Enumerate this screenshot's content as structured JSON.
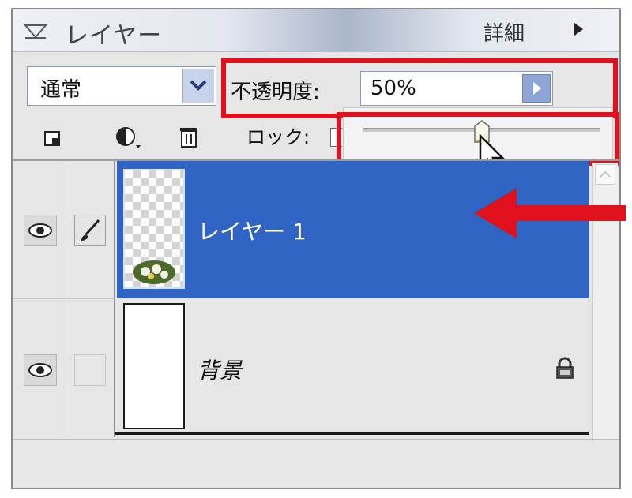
{
  "panel": {
    "title": "レイヤー",
    "details_label": "詳細"
  },
  "options": {
    "blend_mode": "通常",
    "opacity_label": "不透明度:",
    "opacity_value": "50%",
    "opacity_slider_fraction": 0.5,
    "lock_label": "ロック:"
  },
  "layers": [
    {
      "name": "レイヤー 1",
      "selected": true
    },
    {
      "name": "背景",
      "selected": false,
      "locked": true
    }
  ],
  "icons": [
    "collapse-triangle-icon",
    "menu-arrow-icon",
    "new-layer-icon",
    "adjustment-layer-icon",
    "trash-icon",
    "eye-icon",
    "brush-icon",
    "lock-icon"
  ],
  "colors": {
    "selection": "#2f64c4",
    "highlight": "#e0101c"
  }
}
